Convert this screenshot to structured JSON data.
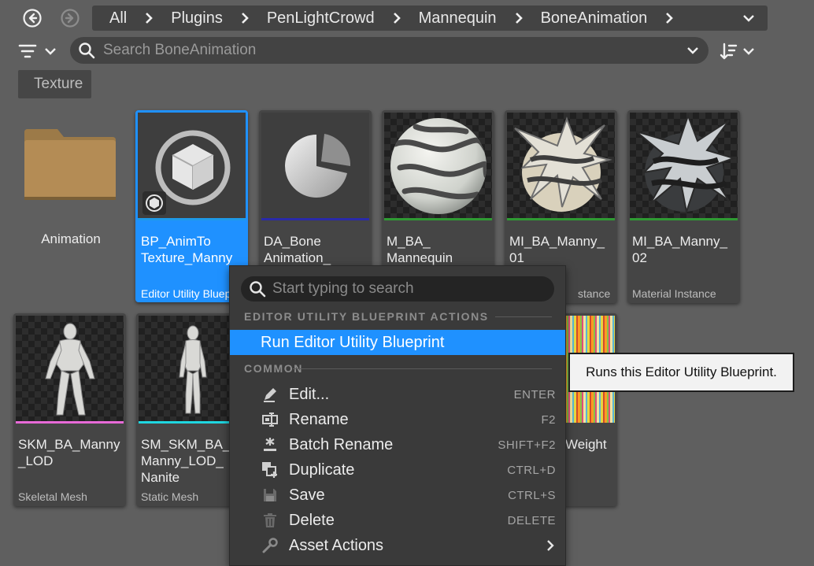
{
  "breadcrumb": [
    "All",
    "Plugins",
    "PenLightCrowd",
    "Mannequin",
    "BoneAnimation"
  ],
  "search": {
    "placeholder": "Search BoneAnimation"
  },
  "filter_chip": "Texture",
  "assets": [
    {
      "name": "Animation",
      "type": "",
      "kind": "folder"
    },
    {
      "name": "BP_AnimTo\nTexture_Manny",
      "type": "Editor Utility Bluep",
      "color": "#1e9ae8",
      "selected": true
    },
    {
      "name": "DA_Bone\nAnimation_",
      "type": "",
      "color": "#2a2aa8"
    },
    {
      "name": "M_BA_\nMannequin",
      "type": "",
      "color": "#2f9a33"
    },
    {
      "name": "MI_BA_Manny_\n01",
      "type": "stance",
      "color": "#2f9a33"
    },
    {
      "name": "MI_BA_Manny_\n02",
      "type": "Material Instance",
      "color": "#2f9a33"
    },
    {
      "name": "SKM_BA_Manny\n_LOD",
      "type": "Skeletal Mesh",
      "color": "#e86ad8"
    },
    {
      "name": "SM_SKM_BA_\nManny_LOD_\nNanite",
      "type": "Static Mesh",
      "color": "#1fd6e0"
    },
    {
      "name": "Weight",
      "type": ""
    }
  ],
  "context_menu": {
    "search_placeholder": "Start typing to search",
    "section_editor": "EDITOR UTILITY BLUEPRINT ACTIONS",
    "run_label": "Run Editor Utility Blueprint",
    "section_common": "COMMON",
    "items": [
      {
        "label": "Edit...",
        "shortcut": "ENTER",
        "icon": "pencil-icon"
      },
      {
        "label": "Rename",
        "shortcut": "F2",
        "icon": "rename-icon"
      },
      {
        "label": "Batch Rename",
        "shortcut": "SHIFT+F2",
        "icon": "batch-rename-icon"
      },
      {
        "label": "Duplicate",
        "shortcut": "CTRL+D",
        "icon": "duplicate-icon"
      },
      {
        "label": "Save",
        "shortcut": "CTRL+S",
        "icon": "save-icon"
      },
      {
        "label": "Delete",
        "shortcut": "DELETE",
        "icon": "trash-icon"
      },
      {
        "label": "Asset Actions",
        "shortcut": "",
        "icon": "wrench-icon"
      }
    ]
  },
  "tooltip": "Runs this Editor Utility Blueprint."
}
